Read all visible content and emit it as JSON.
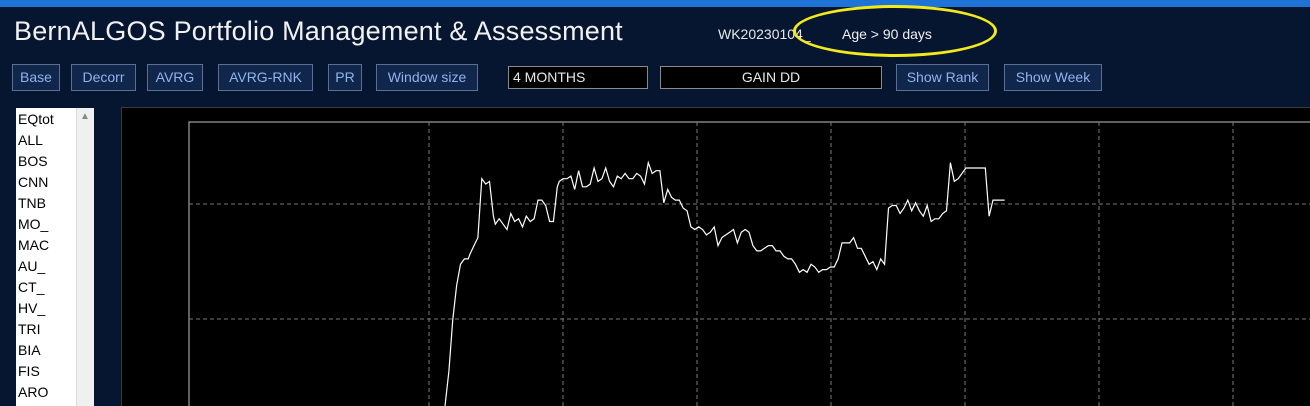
{
  "header": {
    "title": "BernALGOS Portfolio Management & Assessment",
    "week_id": "WK20230104_",
    "age_label": "Age > 90 days",
    "highlight_color": "#f2ea1c"
  },
  "toolbar": {
    "buttons": [
      {
        "label": "Base"
      },
      {
        "label": "Decorr"
      },
      {
        "label": "AVRG"
      },
      {
        "label": "AVRG-RNK"
      },
      {
        "label": "PR"
      },
      {
        "label": "Window size"
      }
    ],
    "window_size_value": "4 MONTHS",
    "metric_value": "GAIN    DD",
    "show_rank_label": "Show Rank",
    "show_week_label": "Show Week"
  },
  "sidebar": {
    "items": [
      "EQtot",
      "ALL",
      "BOS",
      "CNN",
      "TNB",
      "MO_",
      "MAC",
      "AU_",
      "CT_",
      "HV_",
      "TRI",
      "BIA",
      "FIS",
      "ARO"
    ]
  },
  "colors": {
    "accent": "#1e73d6",
    "button_text": "#8fb3f0",
    "chart_bg": "#000000",
    "line": "#ffffff"
  },
  "chart_data": {
    "type": "line",
    "title": "",
    "xlabel": "",
    "ylabel": "",
    "grid": true,
    "x": [
      0,
      4,
      8,
      12,
      16,
      20,
      24,
      26,
      30,
      34,
      38,
      42,
      46,
      50,
      52,
      56,
      60,
      64,
      68,
      72,
      76,
      80,
      84,
      88,
      92,
      96,
      100,
      104,
      108,
      112,
      116,
      118,
      122,
      126,
      130,
      134,
      138,
      142,
      146,
      150,
      154,
      158,
      162,
      166,
      170,
      174,
      178,
      182,
      186,
      190,
      194,
      198,
      202,
      206,
      210,
      214,
      218,
      222,
      226,
      230,
      234,
      238,
      242,
      246,
      250,
      254,
      258,
      262,
      266,
      270,
      274,
      278,
      282,
      286,
      290,
      294,
      298,
      302,
      306,
      310,
      314,
      318,
      322,
      326,
      330,
      334,
      338,
      342,
      346,
      350,
      354,
      358,
      362,
      366,
      370,
      374,
      378,
      382,
      386,
      390,
      394,
      398,
      402,
      406,
      410,
      414,
      418,
      422,
      426,
      430,
      434,
      438,
      442,
      446,
      450,
      454,
      458,
      462,
      466,
      470,
      474,
      478,
      482,
      486,
      490,
      494,
      498,
      502,
      506,
      510,
      514,
      518,
      522,
      526,
      530,
      534,
      538,
      542,
      546,
      550,
      554,
      558,
      562,
      566,
      570,
      574,
      578,
      582,
      586,
      590,
      594,
      598,
      602,
      606,
      610,
      614,
      618,
      622,
      626,
      630,
      634,
      638,
      642,
      646,
      650,
      654,
      658,
      662,
      666,
      670,
      674,
      678,
      682,
      686,
      690,
      694,
      698,
      702,
      706,
      710,
      714,
      718,
      722,
      726,
      730,
      734,
      738,
      742,
      746,
      750,
      754,
      758,
      762,
      766,
      770,
      774,
      778,
      782,
      786,
      790,
      794,
      798,
      802,
      806,
      810,
      814,
      818,
      822,
      826,
      830,
      834,
      838,
      842,
      846,
      850
    ],
    "values": [
      -5,
      8,
      27,
      40,
      48,
      50,
      50,
      52,
      55,
      58,
      80,
      78,
      79,
      66,
      63,
      65,
      63,
      61,
      67,
      64,
      65,
      62,
      66,
      64,
      65,
      72,
      72,
      70,
      64,
      64,
      77,
      79,
      80,
      80,
      81,
      76,
      83,
      77,
      77,
      78,
      84,
      79,
      80,
      84,
      79,
      77,
      81,
      80,
      82,
      80,
      80,
      82,
      81,
      78,
      86,
      82,
      83,
      83,
      71,
      76,
      73,
      72,
      72,
      69,
      68,
      62,
      61,
      62,
      61,
      59,
      60,
      62,
      55,
      58,
      59,
      60,
      61,
      56,
      60,
      61,
      60,
      55,
      53,
      53,
      54,
      55,
      55,
      53,
      53,
      51,
      50,
      50,
      48,
      45,
      46,
      45,
      48,
      47,
      45,
      46,
      46,
      47,
      47,
      50,
      56,
      56,
      56,
      58,
      54,
      54,
      51,
      48,
      49,
      46,
      50,
      48,
      69,
      70,
      70,
      67,
      69,
      72,
      68,
      71,
      68,
      66,
      70,
      64,
      65,
      65,
      67,
      68,
      86,
      79,
      80,
      82,
      84,
      84,
      84,
      84,
      84,
      84,
      66,
      72,
      72,
      72,
      72
    ]
  }
}
